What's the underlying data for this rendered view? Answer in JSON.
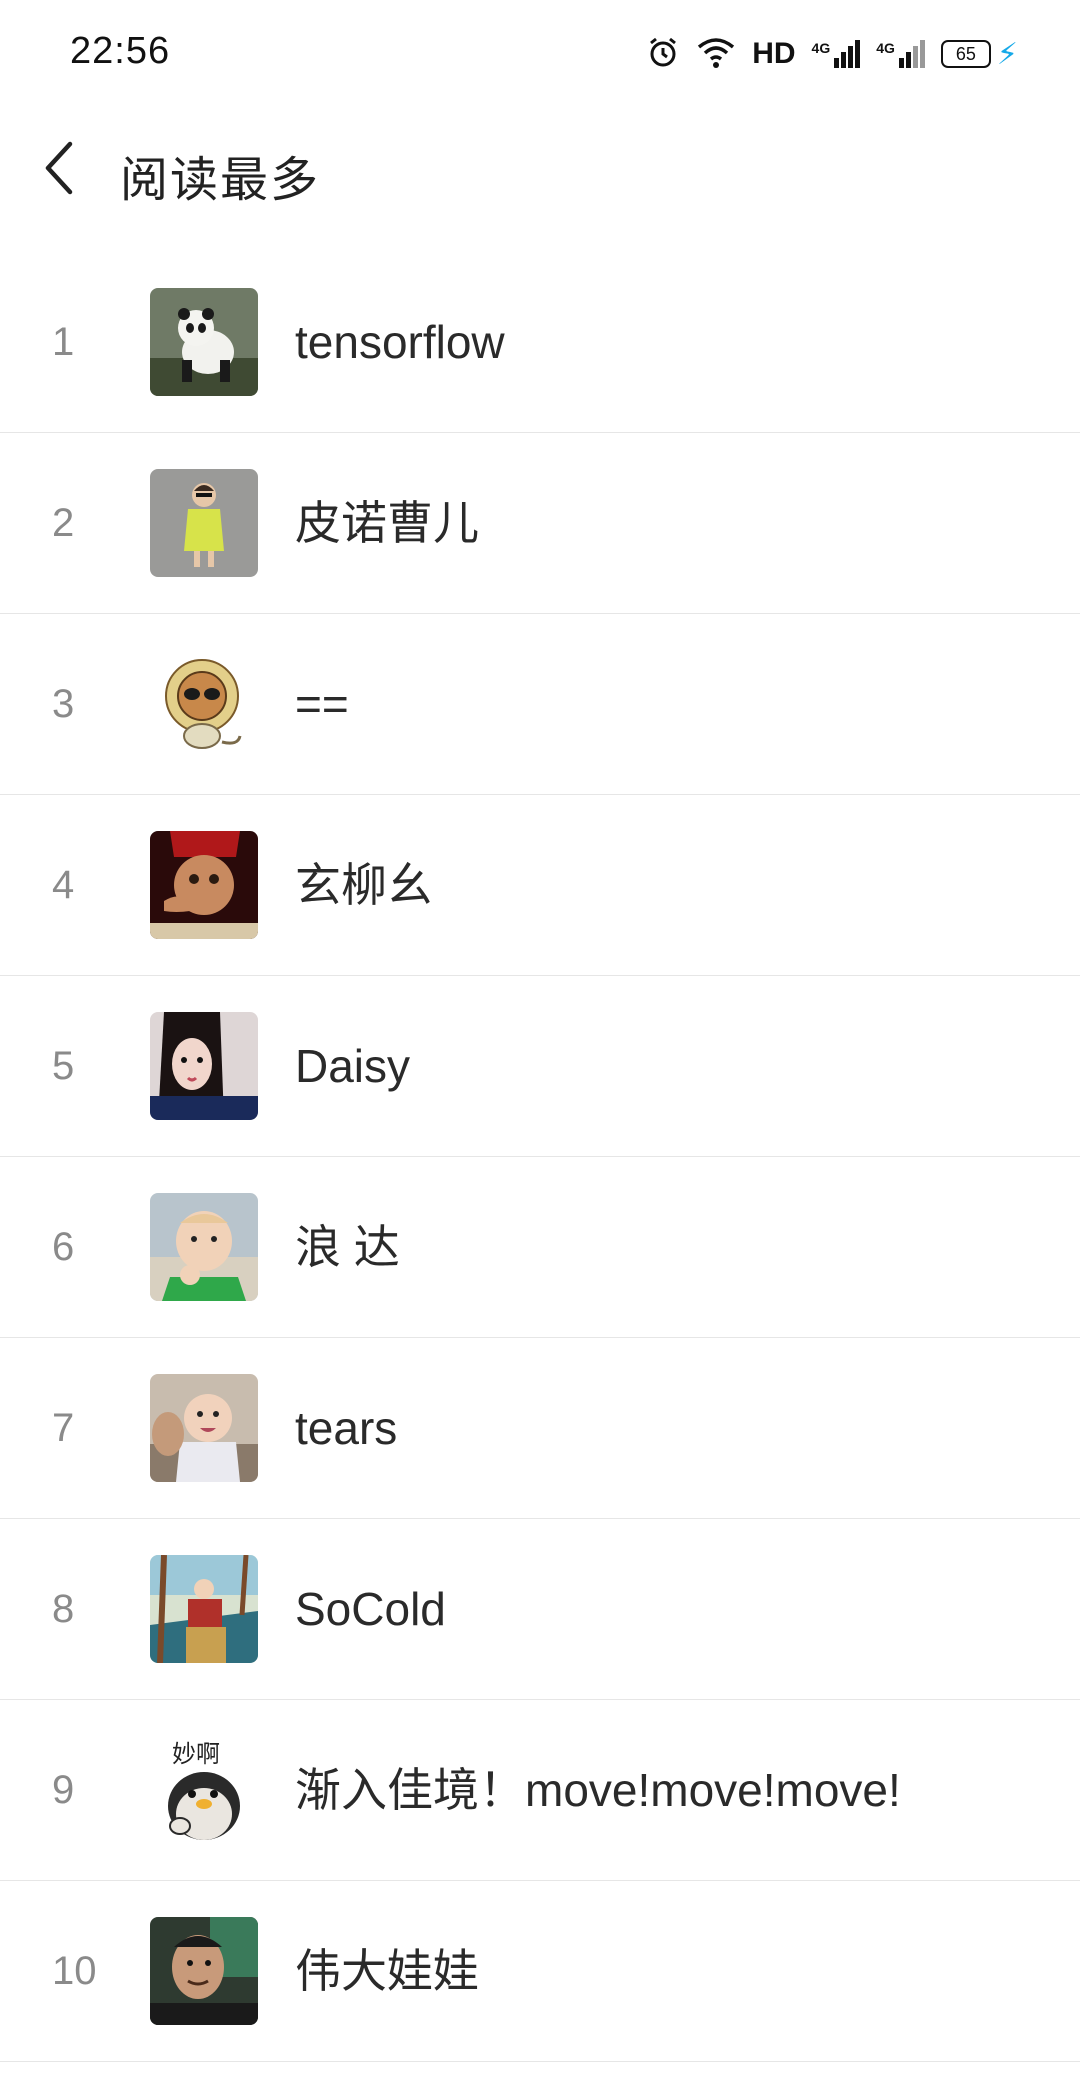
{
  "status_bar": {
    "time": "22:56",
    "hd_label": "HD",
    "network_1": "4G",
    "network_2": "4G",
    "battery_level": "65"
  },
  "header": {
    "title": "阅读最多"
  },
  "list": [
    {
      "rank": "1",
      "name": "tensorflow"
    },
    {
      "rank": "2",
      "name": "皮诺曹儿"
    },
    {
      "rank": "3",
      "name": "=="
    },
    {
      "rank": "4",
      "name": "玄柳幺"
    },
    {
      "rank": "5",
      "name": "Daisy"
    },
    {
      "rank": "6",
      "name": "浪 达"
    },
    {
      "rank": "7",
      "name": "tears"
    },
    {
      "rank": "8",
      "name": "SoCold"
    },
    {
      "rank": "9",
      "name": "渐入佳境！move!move!move!",
      "avatar_text": "妙啊"
    },
    {
      "rank": "10",
      "name": "伟大娃娃"
    }
  ]
}
